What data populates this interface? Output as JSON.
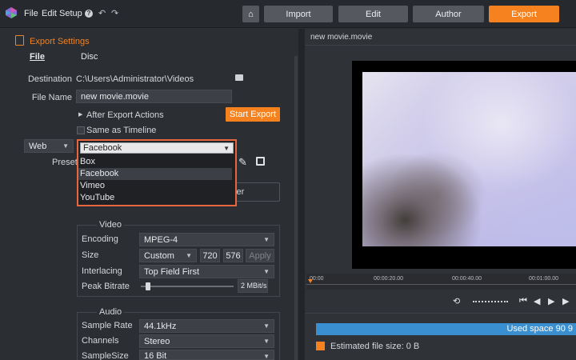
{
  "menu": {
    "file": "File",
    "edit": "Edit",
    "setup": "Setup"
  },
  "tabs": {
    "import": "Import",
    "edit": "Edit",
    "author": "Author",
    "export": "Export",
    "active": "Export"
  },
  "export_settings": {
    "title": "Export Settings",
    "subtabs": {
      "file": "File",
      "disc": "Disc"
    },
    "destination_label": "Destination",
    "destination_value": "C:\\Users\\Administrator\\Videos",
    "filename_label": "File Name",
    "filename_value": "new movie.movie",
    "after_export_label": "After Export Actions",
    "start_export_label": "Start Export",
    "same_as_timeline_label": "Same as Timeline",
    "format_value": "Web",
    "preset_label": "Preset",
    "preset_selected": "Facebook",
    "preset_options": [
      "Box",
      "Facebook",
      "Vimeo",
      "YouTube"
    ],
    "obscured_button_text": "lder"
  },
  "video": {
    "title": "Video",
    "encoding_label": "Encoding",
    "encoding_value": "MPEG-4",
    "size_label": "Size",
    "size_value": "Custom",
    "width_value": "720",
    "height_value": "576",
    "apply_label": "Apply",
    "interlacing_label": "Interlacing",
    "interlacing_value": "Top Field First",
    "peak_bitrate_label": "Peak Bitrate",
    "peak_bitrate_value": "2",
    "peak_bitrate_unit": "MBit/s",
    "peak_bitrate_level": 0.08
  },
  "audio": {
    "title": "Audio",
    "sample_rate_label": "Sample Rate",
    "sample_rate_value": "44.1kHz",
    "channels_label": "Channels",
    "channels_value": "Stereo",
    "sample_size_label": "SampleSize",
    "sample_size_value": "16 Bit"
  },
  "preview": {
    "title": "new movie.movie",
    "ruler_ticks": [
      "00:00",
      "00:00:20.00",
      "00:00:40.00",
      "00:01:00.00"
    ]
  },
  "disk": {
    "used_space_text": "Used space 90 9",
    "estimated_size_text": "Estimated file size: 0 B"
  },
  "colors": {
    "accent": "#f5821f",
    "highlight_border": "#e8663d",
    "usage_bar": "#3a8fd0"
  }
}
